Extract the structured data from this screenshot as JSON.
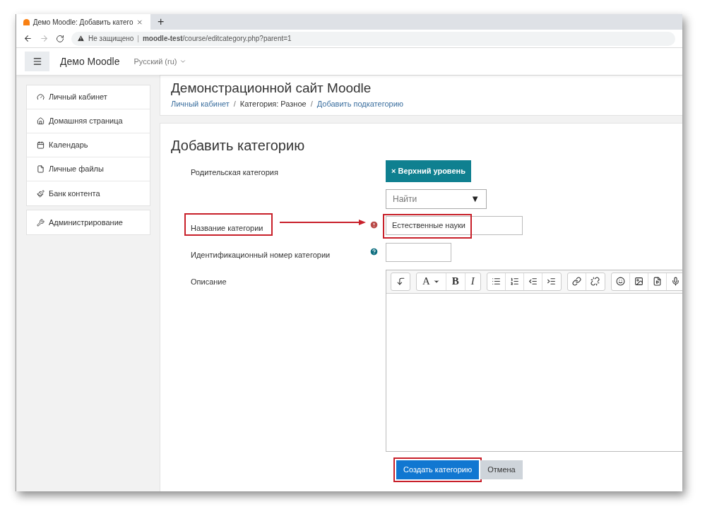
{
  "browser": {
    "tabs": [
      {
        "title": "Демо Moodle: Добавить катего",
        "selected": true
      }
    ],
    "new_tab": "+",
    "security": "Не защищено",
    "separator": "|",
    "url": "**moodle-test**/course/editcategory.php?parent=1"
  },
  "navbar": {
    "site_name": "Демо Moodle",
    "language": "Русский (ru)"
  },
  "sidebar": [
    {
      "items": [
        "Личный кабинет",
        "Домашняя страница",
        "Календарь",
        "Личные файлы",
        "Банк контента"
      ]
    },
    {
      "items": [
        "Администрирование"
      ]
    }
  ],
  "header": {
    "title": "Демонстрационной сайт Moodle",
    "separator": "/",
    "breadcrumb": [
      {
        "label": "Личный кабинет",
        "kind": "link"
      },
      {
        "label": "Категория: Разное",
        "kind": "text"
      },
      {
        "label": "Добавить подкатегорию",
        "kind": "link"
      }
    ]
  },
  "form": {
    "title": "Добавить категорию",
    "rows": [
      {
        "kind": "autocomplete",
        "label": "Родительская категория",
        "chip": "× Верхний уровень",
        "placeholder": "Найти",
        "caret": "▼"
      },
      {
        "kind": "text",
        "label": "Название категории",
        "required": true,
        "value": "Естественные науки",
        "highlighted": true,
        "arrow": true
      },
      {
        "kind": "short",
        "label": "Идентификационный номер категории",
        "help": true
      },
      {
        "kind": "editor",
        "label": "Описание",
        "toolbar": [
          [
            {
              "kind": "icon"
            }
          ],
          [
            {
              "kind": "font",
              "label": "A",
              "caret": true
            },
            {
              "kind": "bold",
              "label": "B"
            },
            {
              "kind": "italic",
              "label": "I"
            }
          ],
          [
            {
              "kind": "icon"
            },
            {
              "kind": "icon"
            },
            {
              "kind": "icon"
            },
            {
              "kind": "icon"
            }
          ],
          [
            {
              "kind": "icon"
            },
            {
              "kind": "icon"
            }
          ],
          [
            {
              "kind": "icon"
            },
            {
              "kind": "icon"
            },
            {
              "kind": "icon"
            },
            {
              "kind": "icon"
            }
          ]
        ]
      }
    ],
    "buttons": [
      {
        "label": "Создать категорию",
        "kind": "primary",
        "highlighted": true
      },
      {
        "label": "Отмена",
        "kind": "secondary",
        "highlighted": false
      }
    ]
  }
}
